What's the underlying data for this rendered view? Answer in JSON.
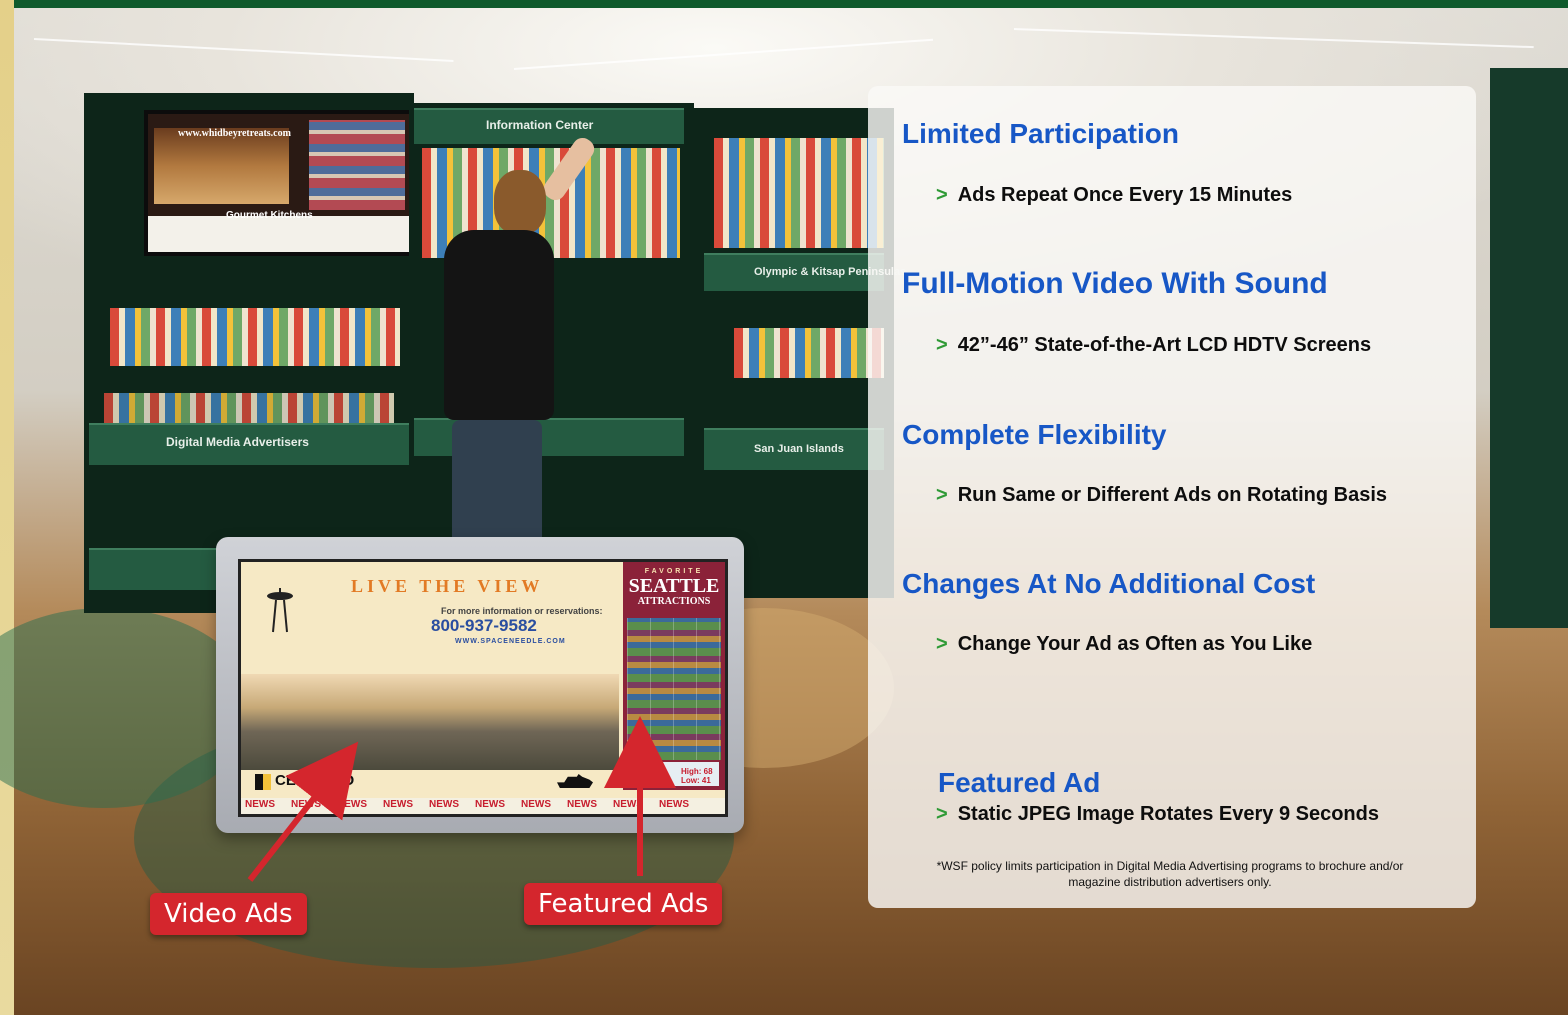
{
  "monitor_screen": {
    "headline": "LIVE THE VIEW",
    "info_line": "For more information or reservations:",
    "phone": "800-937-9582",
    "website": "WWW.SPACENEEDLE.COM",
    "sidebar_kicker": "FAVORITE",
    "sidebar_title": "SEATTLE",
    "sidebar_subtitle": "ATTRACTIONS",
    "weather_city": "SEATTLE",
    "weather_high": "High: 68",
    "weather_low": "Low: 41",
    "certified": "CERTIFIED",
    "ticker": [
      "NEWS",
      "NEWS",
      "NEWS",
      "NEWS",
      "NEWS",
      "NEWS",
      "NEWS",
      "NEWS",
      "NEWS",
      "NEWS"
    ]
  },
  "background_signs": {
    "small_screen_url": "www.whidbeyretreats.com",
    "small_screen_caption": "Gourmet Kitchens",
    "rack_left": "Digital Media Advertisers",
    "rack_center_top": "Information Center",
    "rack_right_top": "Olympic & Kitsap Peninsulas",
    "rack_right_bottom": "San Juan Islands"
  },
  "callouts": {
    "video": "Video Ads",
    "featured": "Featured Ads"
  },
  "features": [
    {
      "heading": "Limited Participation",
      "bullet": "Ads Repeat Once Every 15 Minutes"
    },
    {
      "heading": "Full-Motion Video With Sound",
      "bullet": "42”-46” State-of-the-Art LCD HDTV Screens"
    },
    {
      "heading": "Complete Flexibility",
      "bullet": "Run Same or Different Ads on Rotating Basis"
    },
    {
      "heading": "Changes At No Additional Cost",
      "bullet": "Change Your Ad as Often as You Like"
    },
    {
      "heading": "Featured Ad",
      "bullet": "Static JPEG Image Rotates Every 9 Seconds"
    }
  ],
  "bullet_marker": ">",
  "footnote": "*WSF policy limits participation in Digital Media Advertising programs to brochure and/or magazine distribution advertisers only.",
  "colors": {
    "heading": "#1757c6",
    "bullet_marker": "#2f9a36",
    "callout_bg": "#d4262d",
    "top_bar": "#0f5a2c"
  }
}
